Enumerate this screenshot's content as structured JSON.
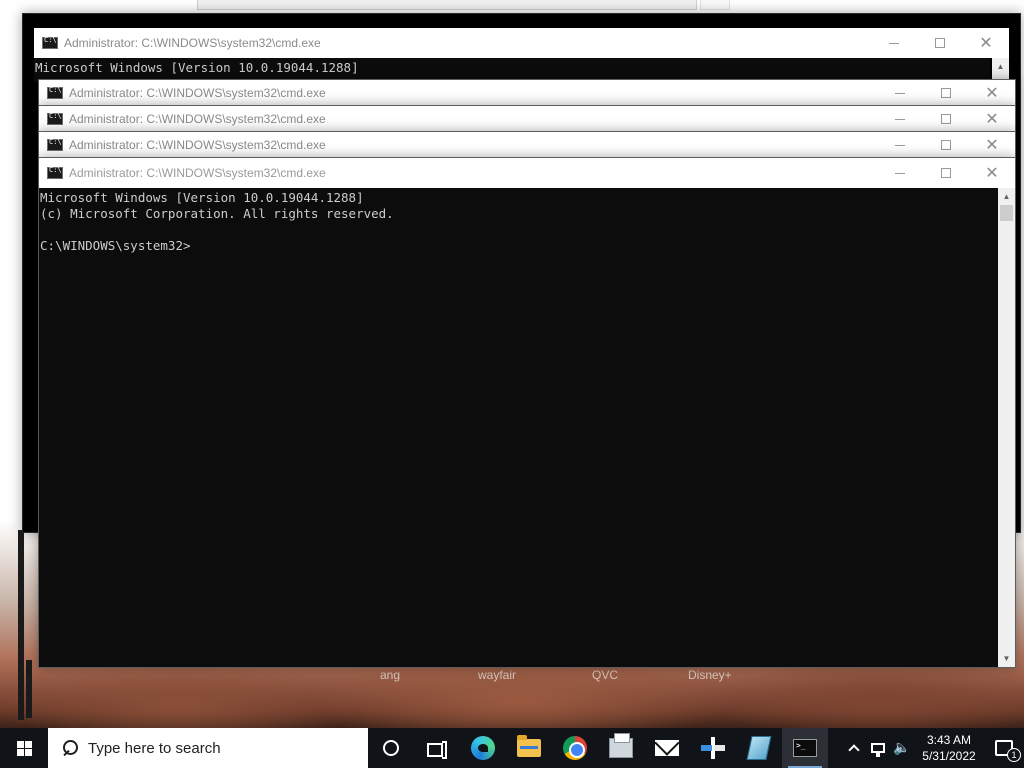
{
  "window_title": "Administrator: C:\\WINDOWS\\system32\\cmd.exe",
  "windows": [
    {
      "title": "Administrator: C:\\WINDOWS\\system32\\cmd.exe"
    },
    {
      "title": "Administrator: C:\\WINDOWS\\system32\\cmd.exe"
    },
    {
      "title": "Administrator: C:\\WINDOWS\\system32\\cmd.exe"
    },
    {
      "title": "Administrator: C:\\WINDOWS\\system32\\cmd.exe"
    },
    {
      "title": "Administrator: C:\\WINDOWS\\system32\\cmd.exe"
    }
  ],
  "console": {
    "line1": "Microsoft Windows [Version 10.0.19044.1288]",
    "line2": "(c) Microsoft Corporation. All rights reserved.",
    "prompt": "C:\\WINDOWS\\system32>"
  },
  "back_console": {
    "line1": "Microsoft Windows [Version 10.0.19044.1288]"
  },
  "desktop_labels": [
    "ang",
    "wayfair",
    "QVC",
    "Disney+"
  ],
  "taskbar": {
    "search_placeholder": "Type here to search",
    "icons": [
      "cortana-icon",
      "task-view-icon",
      "edge-icon",
      "file-explorer-icon",
      "chrome-icon",
      "printer-app-icon",
      "mail-icon",
      "transfer-app-icon",
      "notebook-app-icon",
      "command-prompt-icon"
    ],
    "time": "3:43 AM",
    "date": "5/31/2022",
    "notification_count": "1"
  },
  "colors": {
    "console_bg": "#0c0c0c",
    "console_text": "#cccccc",
    "taskbar_bg": "#101418",
    "titlebar_bg": "#ffffff",
    "title_text": "#999999"
  }
}
